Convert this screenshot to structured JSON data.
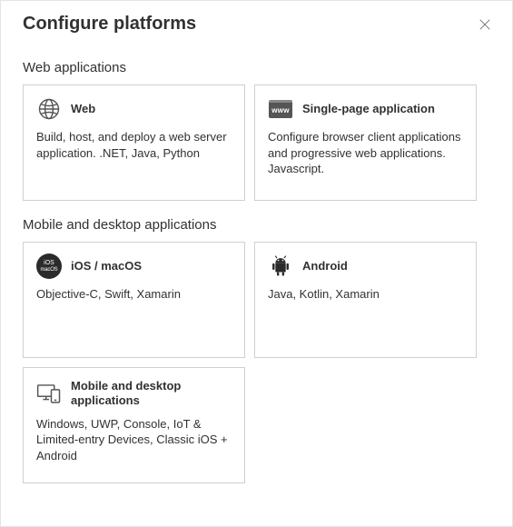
{
  "header": {
    "title": "Configure platforms"
  },
  "sections": {
    "web": {
      "label": "Web applications",
      "cards": {
        "web": {
          "title": "Web",
          "desc": "Build, host, and deploy a web server application. .NET, Java, Python"
        },
        "spa": {
          "title": "Single-page application",
          "desc": "Configure browser client applications and progressive web applications. Javascript."
        }
      }
    },
    "mobile": {
      "label": "Mobile and desktop applications",
      "cards": {
        "ios": {
          "title": "iOS / macOS",
          "desc": "Objective-C, Swift, Xamarin",
          "badge_line1": "iOS",
          "badge_line2": "macOS"
        },
        "android": {
          "title": "Android",
          "desc": "Java, Kotlin, Xamarin"
        },
        "desktop": {
          "title": "Mobile and desktop applications",
          "desc": "Windows, UWP, Console, IoT & Limited-entry Devices, Classic iOS + Android"
        }
      }
    }
  },
  "icons": {
    "www_text": "www"
  }
}
